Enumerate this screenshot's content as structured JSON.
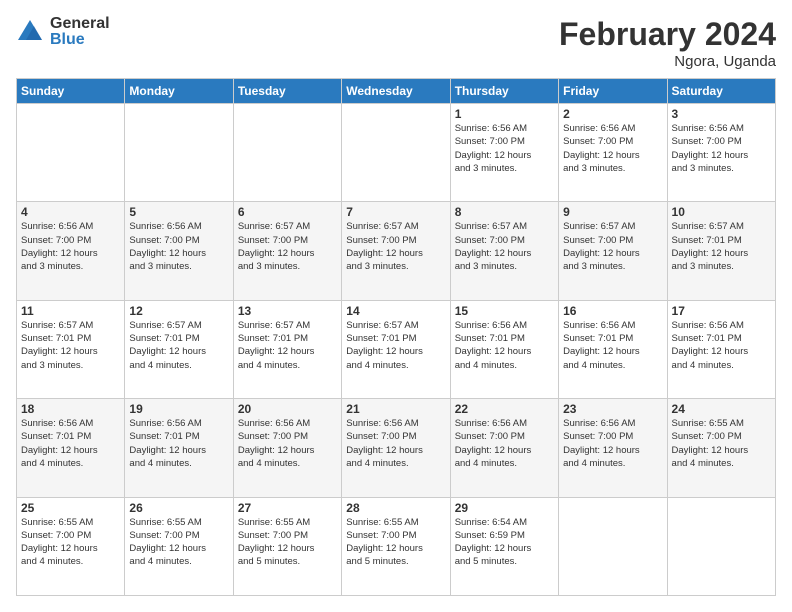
{
  "logo": {
    "general": "General",
    "blue": "Blue"
  },
  "title": "February 2024",
  "subtitle": "Ngora, Uganda",
  "days_header": [
    "Sunday",
    "Monday",
    "Tuesday",
    "Wednesday",
    "Thursday",
    "Friday",
    "Saturday"
  ],
  "weeks": [
    [
      {
        "day": "",
        "info": ""
      },
      {
        "day": "",
        "info": ""
      },
      {
        "day": "",
        "info": ""
      },
      {
        "day": "",
        "info": ""
      },
      {
        "day": "1",
        "info": "Sunrise: 6:56 AM\nSunset: 7:00 PM\nDaylight: 12 hours\nand 3 minutes."
      },
      {
        "day": "2",
        "info": "Sunrise: 6:56 AM\nSunset: 7:00 PM\nDaylight: 12 hours\nand 3 minutes."
      },
      {
        "day": "3",
        "info": "Sunrise: 6:56 AM\nSunset: 7:00 PM\nDaylight: 12 hours\nand 3 minutes."
      }
    ],
    [
      {
        "day": "4",
        "info": "Sunrise: 6:56 AM\nSunset: 7:00 PM\nDaylight: 12 hours\nand 3 minutes."
      },
      {
        "day": "5",
        "info": "Sunrise: 6:56 AM\nSunset: 7:00 PM\nDaylight: 12 hours\nand 3 minutes."
      },
      {
        "day": "6",
        "info": "Sunrise: 6:57 AM\nSunset: 7:00 PM\nDaylight: 12 hours\nand 3 minutes."
      },
      {
        "day": "7",
        "info": "Sunrise: 6:57 AM\nSunset: 7:00 PM\nDaylight: 12 hours\nand 3 minutes."
      },
      {
        "day": "8",
        "info": "Sunrise: 6:57 AM\nSunset: 7:00 PM\nDaylight: 12 hours\nand 3 minutes."
      },
      {
        "day": "9",
        "info": "Sunrise: 6:57 AM\nSunset: 7:00 PM\nDaylight: 12 hours\nand 3 minutes."
      },
      {
        "day": "10",
        "info": "Sunrise: 6:57 AM\nSunset: 7:01 PM\nDaylight: 12 hours\nand 3 minutes."
      }
    ],
    [
      {
        "day": "11",
        "info": "Sunrise: 6:57 AM\nSunset: 7:01 PM\nDaylight: 12 hours\nand 3 minutes."
      },
      {
        "day": "12",
        "info": "Sunrise: 6:57 AM\nSunset: 7:01 PM\nDaylight: 12 hours\nand 4 minutes."
      },
      {
        "day": "13",
        "info": "Sunrise: 6:57 AM\nSunset: 7:01 PM\nDaylight: 12 hours\nand 4 minutes."
      },
      {
        "day": "14",
        "info": "Sunrise: 6:57 AM\nSunset: 7:01 PM\nDaylight: 12 hours\nand 4 minutes."
      },
      {
        "day": "15",
        "info": "Sunrise: 6:56 AM\nSunset: 7:01 PM\nDaylight: 12 hours\nand 4 minutes."
      },
      {
        "day": "16",
        "info": "Sunrise: 6:56 AM\nSunset: 7:01 PM\nDaylight: 12 hours\nand 4 minutes."
      },
      {
        "day": "17",
        "info": "Sunrise: 6:56 AM\nSunset: 7:01 PM\nDaylight: 12 hours\nand 4 minutes."
      }
    ],
    [
      {
        "day": "18",
        "info": "Sunrise: 6:56 AM\nSunset: 7:01 PM\nDaylight: 12 hours\nand 4 minutes."
      },
      {
        "day": "19",
        "info": "Sunrise: 6:56 AM\nSunset: 7:01 PM\nDaylight: 12 hours\nand 4 minutes."
      },
      {
        "day": "20",
        "info": "Sunrise: 6:56 AM\nSunset: 7:00 PM\nDaylight: 12 hours\nand 4 minutes."
      },
      {
        "day": "21",
        "info": "Sunrise: 6:56 AM\nSunset: 7:00 PM\nDaylight: 12 hours\nand 4 minutes."
      },
      {
        "day": "22",
        "info": "Sunrise: 6:56 AM\nSunset: 7:00 PM\nDaylight: 12 hours\nand 4 minutes."
      },
      {
        "day": "23",
        "info": "Sunrise: 6:56 AM\nSunset: 7:00 PM\nDaylight: 12 hours\nand 4 minutes."
      },
      {
        "day": "24",
        "info": "Sunrise: 6:55 AM\nSunset: 7:00 PM\nDaylight: 12 hours\nand 4 minutes."
      }
    ],
    [
      {
        "day": "25",
        "info": "Sunrise: 6:55 AM\nSunset: 7:00 PM\nDaylight: 12 hours\nand 4 minutes."
      },
      {
        "day": "26",
        "info": "Sunrise: 6:55 AM\nSunset: 7:00 PM\nDaylight: 12 hours\nand 4 minutes."
      },
      {
        "day": "27",
        "info": "Sunrise: 6:55 AM\nSunset: 7:00 PM\nDaylight: 12 hours\nand 5 minutes."
      },
      {
        "day": "28",
        "info": "Sunrise: 6:55 AM\nSunset: 7:00 PM\nDaylight: 12 hours\nand 5 minutes."
      },
      {
        "day": "29",
        "info": "Sunrise: 6:54 AM\nSunset: 6:59 PM\nDaylight: 12 hours\nand 5 minutes."
      },
      {
        "day": "",
        "info": ""
      },
      {
        "day": "",
        "info": ""
      }
    ]
  ]
}
